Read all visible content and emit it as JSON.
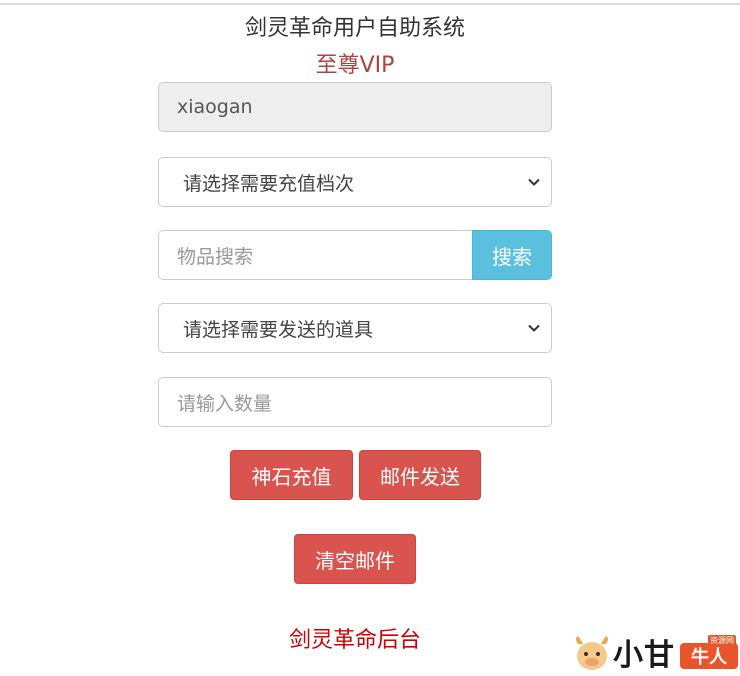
{
  "header": {
    "title": "剑灵革命用户自助系统",
    "subtitle": "至尊VIP"
  },
  "form": {
    "username_value": "xiaogan",
    "recharge_select": {
      "selected": "请选择需要充值档次"
    },
    "search": {
      "placeholder": "物品搜索",
      "button_label": "搜索"
    },
    "item_select": {
      "selected": "请选择需要发送的道具"
    },
    "quantity": {
      "placeholder": "请输入数量"
    }
  },
  "actions": {
    "recharge_label": "神石充值",
    "send_mail_label": "邮件发送",
    "clear_mail_label": "清空邮件"
  },
  "footer": {
    "backend_link": "剑灵革命后台"
  },
  "watermark": {
    "brand_text": "小甘",
    "badge_text": "牛人",
    "badge_small": "资源网"
  },
  "colors": {
    "danger": "#d9534f",
    "info": "#5bc0de",
    "subtitle": "#a94442",
    "footer_link": "#cc0000"
  }
}
